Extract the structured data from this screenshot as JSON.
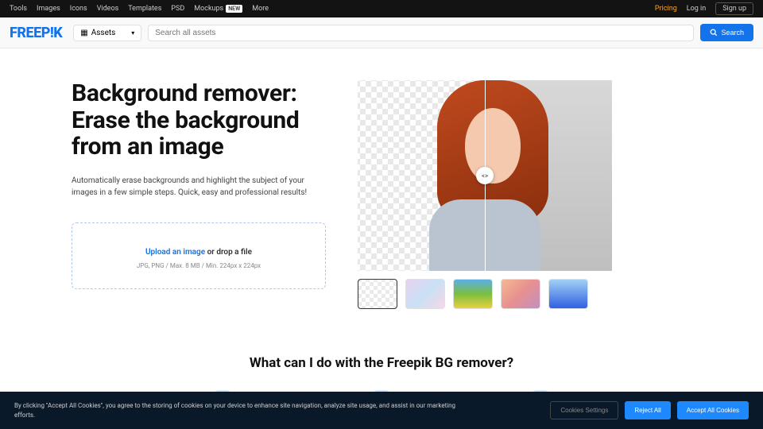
{
  "topbar": {
    "links": [
      "Tools",
      "Images",
      "Icons",
      "Videos",
      "Templates",
      "PSD",
      "Mockups",
      "More"
    ],
    "new_badge": "NEW",
    "pricing": "Pricing",
    "login": "Log in",
    "signup": "Sign up"
  },
  "header": {
    "logo": "FREEP!K",
    "assets_label": "Assets",
    "search_placeholder": "Search all assets",
    "search_btn": "Search"
  },
  "hero": {
    "title": "Background remover: Erase the background from an image",
    "subtitle": "Automatically erase backgrounds and highlight the subject of your images in a few simple steps. Quick, easy and professional results!",
    "upload_link": "Upload an image",
    "upload_text": " or drop a file",
    "upload_sub": "JPG, PNG / Max. 8 MB / Min. 224px x 224px"
  },
  "section": {
    "title": "What can I do with the Freepik BG remover?"
  },
  "cookie": {
    "text": "By clicking \"Accept All Cookies\", you agree to the storing of cookies on your device to enhance site navigation, analyze site usage, and assist in our marketing efforts.",
    "settings": "Cookies Settings",
    "reject": "Reject All",
    "accept": "Accept All Cookies"
  }
}
